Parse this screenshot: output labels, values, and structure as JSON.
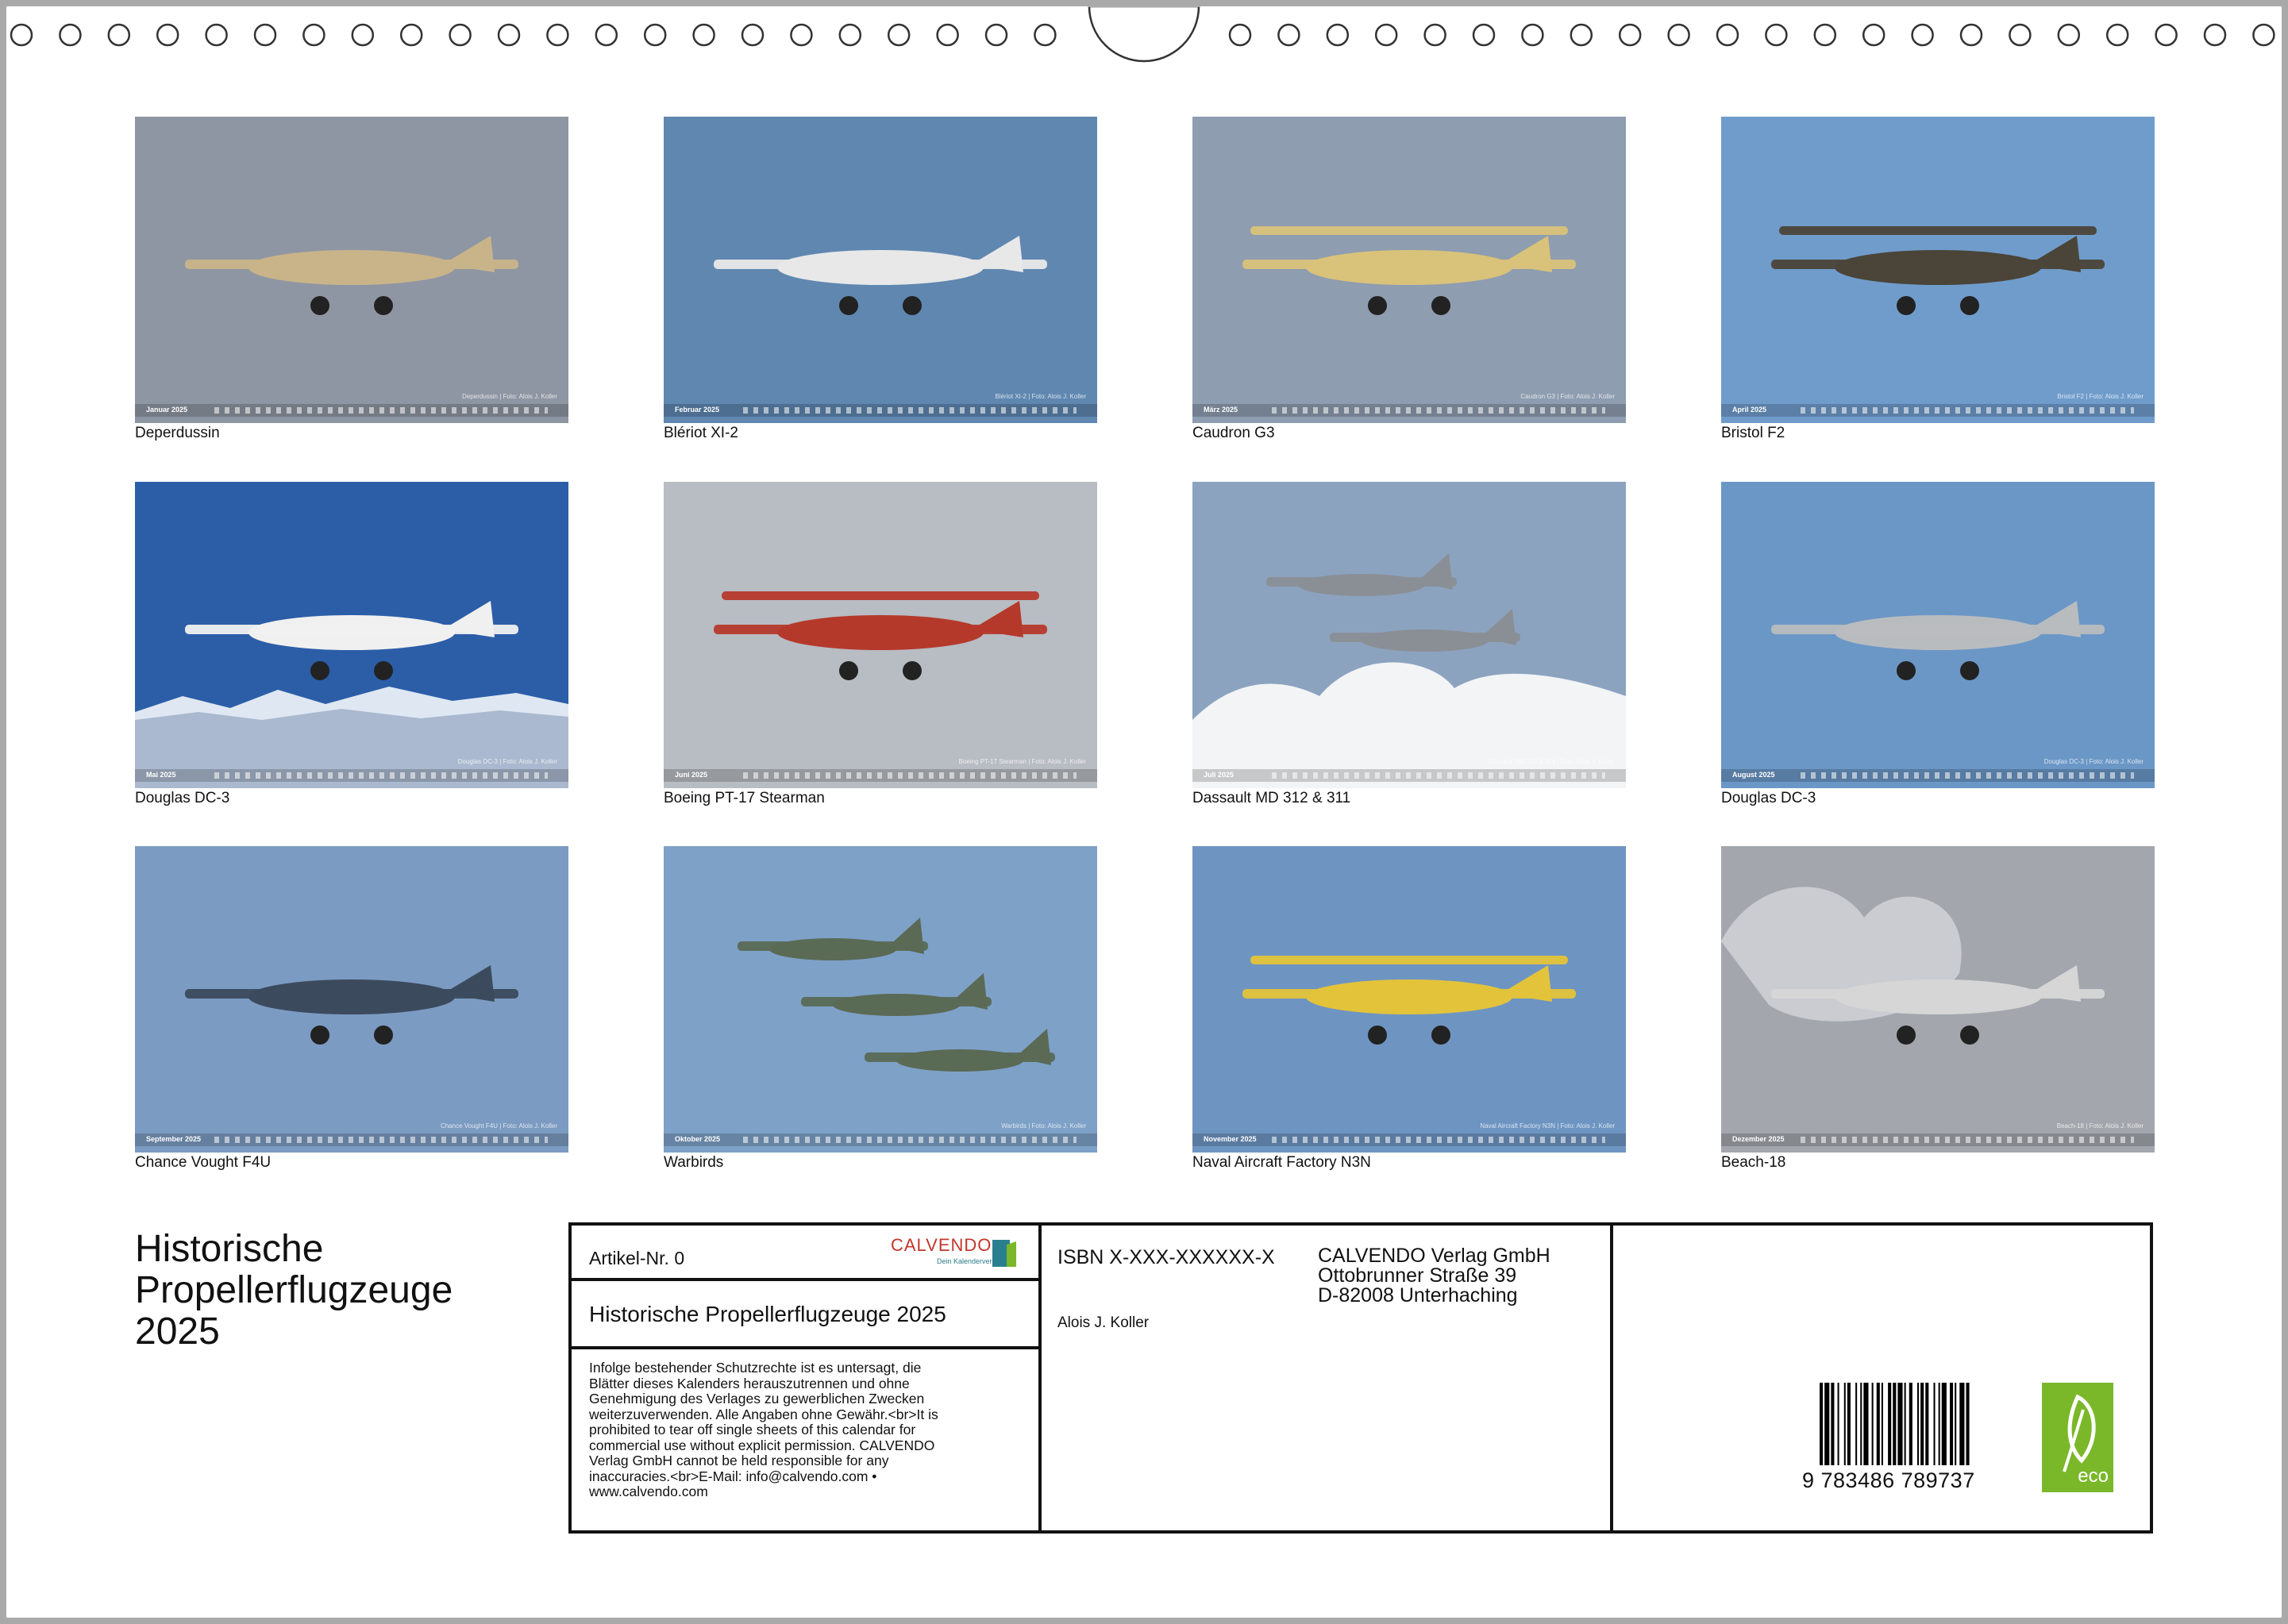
{
  "thumbnails": [
    {
      "month": "Januar 2025",
      "credit": "Deperdussin | Foto: Alois J. Koller",
      "caption": "Deperdussin",
      "sky": "#8f96a3"
    },
    {
      "month": "Februar 2025",
      "credit": "Blériot XI-2 | Foto: Alois J. Koller",
      "caption": "Blériot XI-2",
      "sky": "#5f87b0"
    },
    {
      "month": "März 2025",
      "credit": "Caudron G3 | Foto: Alois J. Koller",
      "caption": "Caudron G3",
      "sky": "#8e9db0"
    },
    {
      "month": "April 2025",
      "credit": "Bristol F2 | Foto: Alois J. Koller",
      "caption": "Bristol F2",
      "sky": "#6f9ccb"
    },
    {
      "month": "Mai 2025",
      "credit": "Douglas DC-3 | Foto: Alois J. Koller",
      "caption": "Douglas DC-3",
      "sky": "#2c5ea8"
    },
    {
      "month": "Juni 2025",
      "credit": "Boeing PT-17 Stearman | Foto: Alois J. Koller",
      "caption": "Boeing PT-17 Stearman",
      "sky": "#b8bcc3"
    },
    {
      "month": "Juli 2025",
      "credit": "Dassault MD 312 & 311 | Foto: Alois J. Koller",
      "caption": "Dassault MD 312 & 311",
      "sky": "#8ca3bf"
    },
    {
      "month": "August 2025",
      "credit": "Douglas DC-3 | Foto: Alois J. Koller",
      "caption": "Douglas DC-3",
      "sky": "#6b97c6"
    },
    {
      "month": "September 2025",
      "credit": "Chance Vought F4U | Foto: Alois J. Koller",
      "caption": "Chance Vought F4U",
      "sky": "#7c9bc2"
    },
    {
      "month": "Oktober 2025",
      "credit": "Warbirds | Foto: Alois J. Koller",
      "caption": "Warbirds",
      "sky": "#7ea1c8"
    },
    {
      "month": "November 2025",
      "credit": "Naval Aircraft Factory N3N | Foto: Alois J. Koller",
      "caption": "Naval Aircraft Factory N3N",
      "sky": "#6e95c2"
    },
    {
      "month": "Dezember 2025",
      "credit": "Beach-18 | Foto: Alois J. Koller",
      "caption": "Beach-18",
      "sky": "#a3a7ad"
    }
  ],
  "title": {
    "line1": "Historische",
    "line2": "Propellerflugzeuge",
    "line3": "2025"
  },
  "info": {
    "artikel": "Artikel-Nr. 0",
    "logo_name": "CALVENDO",
    "logo_sub": "Dein Kalenderverlag",
    "product_title": "Historische Propellerflugzeuge 2025",
    "legal": [
      "Infolge bestehender Schutzrechte ist es untersagt, die",
      "Blätter dieses Kalenders herauszutrennen und ohne",
      "Genehmigung des Verlages zu gewerblichen Zwecken",
      "weiterzuverwenden. Alle Angaben ohne Gewähr.<br>It is",
      "prohibited to tear off single sheets of this calendar for",
      "commercial use without explicit permission. CALVENDO",
      "Verlag GmbH cannot be held responsible for any",
      "inaccuracies.<br>E-Mail: info@calvendo.com •",
      "www.calvendo.com"
    ],
    "isbn": "ISBN X-XXX-XXXXXX-X",
    "author": "Alois J. Koller",
    "publisher": [
      "CALVENDO Verlag GmbH",
      "Ottobrunner Straße 39",
      "D-82008 Unterhaching"
    ],
    "barcode_digits": "9 783486 789737",
    "eco_label": "eco"
  },
  "colors": {
    "accent_green": "#7ab829",
    "frame": "#111111",
    "background": "#a9a9a9"
  }
}
